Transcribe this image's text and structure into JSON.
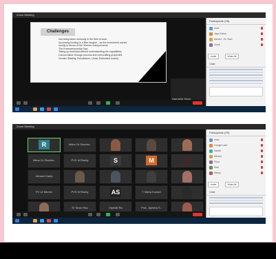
{
  "colors": {
    "background": "#f5c9d2",
    "zoom_dark": "#1b1b1b",
    "end_button": "#e0342f",
    "active_green": "#2db35a",
    "taskbar": "#0c2640"
  },
  "screenshot1": {
    "window_title": "Zoom Meeting",
    "slide": {
      "heading": "Challenges",
      "bullets": [
        "Not being taken seriously in the field of work",
        "Accessing funding is a little tougher - as the investment comes",
        "mostly in favour of the Women entrepreneurs",
        "The Entrepreneurship Gap",
        "Taking up workload without understanding the capabilities",
        "Cannot follow through process and overcrafting properties",
        "Gender Stability, Restrictions, Under Estimated society"
      ]
    },
    "speaker_name": "Namatha Singh",
    "panel": {
      "title": "Participants (28)",
      "rows": [
        "Host",
        "Jaya Shree",
        "Mentor - Dr. Ravi",
        "Vivek",
        "Attendee"
      ],
      "buttons": [
        "Invite",
        "Mute All"
      ],
      "chat_title": "Chat"
    }
  },
  "screenshot2": {
    "window_title": "Zoom Meeting",
    "panel": {
      "title": "Participants (29)",
      "rows": [
        "Host",
        "Google User",
        "Santhi",
        "Mentor",
        "Priya",
        "Ravi",
        "Manoj"
      ],
      "buttons": [
        "Invite",
        "Mute All"
      ],
      "chat_title": "Chat"
    },
    "tiles": [
      {
        "letter": "R",
        "name": "",
        "color": "#2f7f8a",
        "highlight": true
      },
      {
        "letter": "",
        "name": "Vibha Gr Shobho..",
        "color": ""
      },
      {
        "letter": "",
        "name": "",
        "color": "#8a5a44",
        "photo": true
      },
      {
        "letter": "",
        "name": "",
        "color": "#5b4a3e",
        "photo": true
      },
      {
        "letter": "",
        "name": "",
        "color": "#9c6b55",
        "photo": true
      },
      {
        "letter": "",
        "name": "Vibha Gr Shobho..",
        "color": ""
      },
      {
        "letter": "",
        "name": "PVS Iti Reddy",
        "color": ""
      },
      {
        "letter": "S",
        "name": "",
        "color": "#3a3a3a"
      },
      {
        "letter": "M",
        "name": "",
        "color": "#d46a2a"
      },
      {
        "letter": "",
        "name": "",
        "color": "#3b2a2a",
        "photo": true
      },
      {
        "letter": "",
        "name": "Jahnavi Kadry",
        "color": ""
      },
      {
        "letter": "",
        "name": "",
        "color": "#6b5a4a",
        "photo": true
      },
      {
        "letter": "",
        "name": "",
        "color": "#4a5560",
        "photo": true
      },
      {
        "letter": "",
        "name": "",
        "color": "#3e3e3e",
        "photo": true
      },
      {
        "letter": "",
        "name": "",
        "color": "#a36f66",
        "photo": true
      },
      {
        "letter": "",
        "name": "PV Lit Mentor",
        "color": ""
      },
      {
        "letter": "",
        "name": "PVS Iti Reddy",
        "color": ""
      },
      {
        "letter": "AS",
        "name": "",
        "color": "#222"
      },
      {
        "letter": "",
        "name": "T Nisha Kumari",
        "color": ""
      },
      {
        "letter": "",
        "name": "",
        "color": "#2a2a2a",
        "photo": true
      },
      {
        "letter": "",
        "name": "",
        "color": "#8d6a5c",
        "photo": true
      },
      {
        "letter": "",
        "name": "Sr Tarun Rao",
        "color": ""
      },
      {
        "letter": "",
        "name": "Vipinatt Ra",
        "color": ""
      },
      {
        "letter": "",
        "name": "Prat.. Ayesha S..",
        "color": ""
      },
      {
        "letter": "",
        "name": "",
        "color": "#9d5a50",
        "photo": true
      }
    ]
  }
}
